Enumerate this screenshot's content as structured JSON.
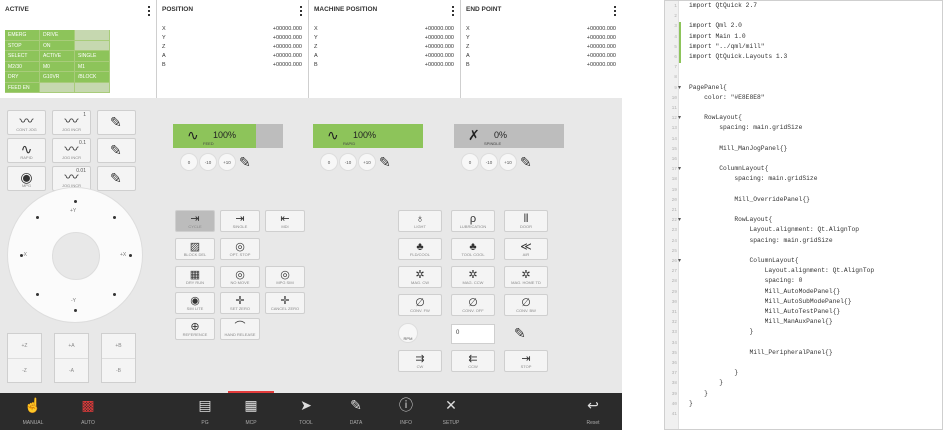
{
  "panels": {
    "active": {
      "title": "ACTIVE"
    },
    "position": {
      "title": "POSITION",
      "rows": [
        {
          "axis": "X",
          "value": "+00000.000"
        },
        {
          "axis": "Y",
          "value": "+00000.000"
        },
        {
          "axis": "Z",
          "value": "+00000.000"
        },
        {
          "axis": "A",
          "value": "+00000.000"
        },
        {
          "axis": "B",
          "value": "+00000.000"
        }
      ]
    },
    "machine": {
      "title": "MACHINE POSITION",
      "rows": [
        {
          "axis": "X",
          "value": "+00000.000"
        },
        {
          "axis": "Y",
          "value": "+00000.000"
        },
        {
          "axis": "Z",
          "value": "+00000.000"
        },
        {
          "axis": "A",
          "value": "+00000.000"
        },
        {
          "axis": "B",
          "value": "+00000.000"
        }
      ]
    },
    "end": {
      "title": "END POINT",
      "rows": [
        {
          "axis": "X",
          "value": "+00000.000"
        },
        {
          "axis": "Y",
          "value": "+00000.000"
        },
        {
          "axis": "Z",
          "value": "+00000.000"
        },
        {
          "axis": "A",
          "value": "+00000.000"
        },
        {
          "axis": "B",
          "value": "+00000.000"
        }
      ]
    }
  },
  "status_rows": [
    [
      "EMERG",
      "DRIVE",
      ""
    ],
    [
      "STOP",
      "ON",
      ""
    ],
    [
      "SELECT",
      "ACTIVE",
      "SINGLE"
    ],
    [
      "M2/30",
      "M0",
      "M1"
    ],
    [
      "DRY",
      "G10VR",
      "/BLOCK"
    ],
    [
      "FEED EN",
      "",
      ""
    ]
  ],
  "status_green": [
    [
      true,
      true,
      false
    ],
    [
      true,
      true,
      false
    ],
    [
      true,
      true,
      true
    ],
    [
      true,
      true,
      true
    ],
    [
      true,
      true,
      true
    ],
    [
      true,
      false,
      false
    ]
  ],
  "jog_modes": [
    {
      "label": "CONT JOG",
      "icon": "〰",
      "sup": ""
    },
    {
      "label": "JOG INCR",
      "icon": "〰",
      "sup": "1"
    },
    {
      "label": "RAPID",
      "icon": "∿",
      "sup": ""
    },
    {
      "label": "JOG INCR",
      "icon": "〰",
      "sup": "0.1"
    },
    {
      "label": "MPG",
      "icon": "◉",
      "sup": ""
    },
    {
      "label": "JOG INCR",
      "icon": "〰",
      "sup": "0.01"
    }
  ],
  "overrides": [
    {
      "name": "feed",
      "percent": "100%",
      "label": "FEED",
      "color": "#8dc45a",
      "fill": 0.75,
      "steps": [
        "0",
        "-10",
        "+10"
      ]
    },
    {
      "name": "rapid",
      "percent": "100%",
      "label": "RAPID",
      "color": "#8dc45a",
      "fill": 1.0,
      "steps": [
        "0",
        "-10",
        "+10"
      ]
    },
    {
      "name": "spindle",
      "percent": "0%",
      "label": "SPINDLE",
      "color": "#bdbdbd",
      "fill": 0.0,
      "steps": [
        "0",
        "-10",
        "+10"
      ]
    }
  ],
  "jog_wheel": {
    "top": "+Y",
    "bottom": "-Y",
    "left": "-X",
    "right": "+X"
  },
  "axis_buttons": [
    [
      "+Z",
      "-Z"
    ],
    [
      "+A",
      "-A"
    ],
    [
      "+B",
      "-B"
    ]
  ],
  "auto_buttons": [
    {
      "id": "cycle",
      "label": "CYCLE",
      "icon": "⇥",
      "dark": true
    },
    {
      "id": "single",
      "label": "SINGLE",
      "icon": "⇥",
      "dark": false
    },
    {
      "id": "mdi",
      "label": "MDI",
      "icon": "⇤",
      "dark": false
    },
    {
      "id": "block-del",
      "label": "BLOCK DEL",
      "icon": "▨",
      "dark": false
    },
    {
      "id": "opt-stop",
      "label": "OPT. STOP",
      "icon": "◎",
      "dark": false
    },
    {
      "id": "dry-run",
      "label": "DRY RUN",
      "icon": "▦",
      "dark": false
    },
    {
      "id": "no-move",
      "label": "NO MOVE",
      "icon": "◎",
      "dark": false
    },
    {
      "id": "mpg-sim",
      "label": "MPG SIM",
      "icon": "◎",
      "dark": false
    },
    {
      "id": "sim-lite",
      "label": "SIM LITE",
      "icon": "◉",
      "dark": false
    },
    {
      "id": "set-zero",
      "label": "SET ZERO",
      "icon": "✛",
      "dark": false
    },
    {
      "id": "cancel-zero",
      "label": "CANCEL ZERO",
      "icon": "✛",
      "dark": false
    },
    {
      "id": "reference",
      "label": "REFERENCE",
      "icon": "⊕",
      "dark": false
    },
    {
      "id": "hand-release",
      "label": "HAND RELEASE",
      "icon": "⌒",
      "dark": false
    }
  ],
  "aux_buttons": [
    {
      "id": "light",
      "label": "LIGHT",
      "icon": "♁"
    },
    {
      "id": "lubrication",
      "label": "LUBRICATION",
      "icon": "ρ"
    },
    {
      "id": "door",
      "label": "DOOR",
      "icon": "⫴"
    },
    {
      "id": "cool",
      "label": "FLD/COOL",
      "icon": "♣"
    },
    {
      "id": "tool-cool",
      "label": "TOOL COOL",
      "icon": "♣"
    },
    {
      "id": "air",
      "label": "AIR",
      "icon": "≪"
    },
    {
      "id": "mag-cw",
      "label": "MAG. CW",
      "icon": "✲"
    },
    {
      "id": "mag-ccw",
      "label": "MAG. CCW",
      "icon": "✲"
    },
    {
      "id": "mag-home",
      "label": "MAG. HOME TD",
      "icon": "✲"
    },
    {
      "id": "conv-fw",
      "label": "CONV. FW",
      "icon": "∅"
    },
    {
      "id": "conv-off",
      "label": "CONV. OFF",
      "icon": "∅"
    },
    {
      "id": "conv-bw",
      "label": "CONV. BW",
      "icon": "∅"
    }
  ],
  "spindle": {
    "rpm_label": "RPM",
    "rpm_value": "0",
    "buttons": [
      {
        "label": "CW",
        "icon": "⇉"
      },
      {
        "label": "CCW",
        "icon": "⇇"
      },
      {
        "label": "STOP",
        "icon": "⇥"
      }
    ]
  },
  "nav_items": [
    {
      "label": "MANUAL",
      "icon": "☝"
    },
    {
      "label": "AUTO",
      "icon": "▩"
    },
    {
      "label": "PG",
      "icon": "▤"
    },
    {
      "label": "MCP",
      "icon": "▦"
    },
    {
      "label": "TOOL",
      "icon": "➤"
    },
    {
      "label": "DATA",
      "icon": "✎"
    },
    {
      "label": "INFO",
      "icon": "ⓘ"
    },
    {
      "label": "SETUP",
      "icon": "✕"
    },
    {
      "label": "Reset",
      "icon": "↩"
    }
  ],
  "code_lines": [
    "import QtQuick 2.7",
    "",
    "import Qml 2.0",
    "import Main 1.0",
    "import \"../qml/mill\"",
    "import QtQuick.Layouts 1.3",
    "",
    "",
    "PagePanel{",
    "    color: \"#E8E8E8\"",
    "",
    "    RowLayout{",
    "        spacing: main.gridSize",
    "",
    "        Mill_ManJogPanel{}",
    "",
    "        ColumnLayout{",
    "            spacing: main.gridSize",
    "",
    "            Mill_OverridePanel{}",
    "",
    "            RowLayout{",
    "                Layout.alignment: Qt.AlignTop",
    "                spacing: main.gridSize",
    "",
    "                ColumnLayout{",
    "                    Layout.alignment: Qt.AlignTop",
    "                    spacing: 0",
    "                    Mill_AutoModePanel{}",
    "                    Mill_AutoSubModePanel{}",
    "                    Mill_AutoTestPanel{}",
    "                    Mill_ManAuxPanel{}",
    "                }",
    "",
    "                Mill_PeripheralPanel{}",
    "",
    "            }",
    "        }",
    "    }",
    "}",
    ""
  ],
  "code_line_numbers": [
    "1",
    "2",
    "3",
    "4",
    "5",
    "6",
    "7",
    "8",
    "9",
    "10",
    "11",
    "12",
    "13",
    "14",
    "15",
    "16",
    "17",
    "18",
    "19",
    "20",
    "21",
    "22",
    "23",
    "24",
    "25",
    "26",
    "27",
    "28",
    "29",
    "30",
    "31",
    "32",
    "33",
    "34",
    "35",
    "36",
    "37",
    "38",
    "39",
    "40",
    "41"
  ],
  "accent": "#8dc45a",
  "alert": "#e23b3b"
}
